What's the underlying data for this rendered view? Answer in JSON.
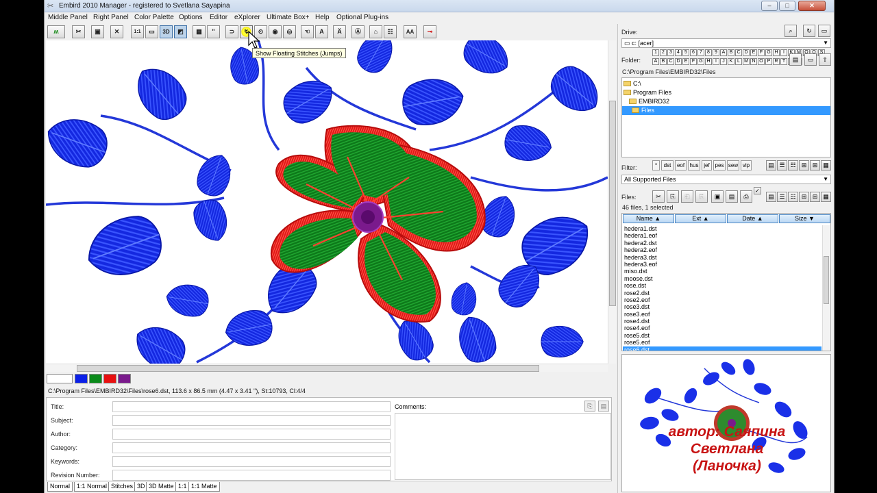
{
  "window": {
    "title": "Embird 2010 Manager - registered to Svetlana Sayapina",
    "minimize": "–",
    "maximize": "□",
    "close": "✕"
  },
  "menu": [
    "Middle Panel",
    "Right Panel",
    "Color Palette",
    "Options",
    "Editor",
    "eXplorer",
    "Ultimate Box+",
    "Help",
    "Optional Plug-ins"
  ],
  "toolbar": {
    "buttons": [
      {
        "name": "stitch-view-icon",
        "glyph": "ʍ"
      },
      {
        "name": "scissors-icon",
        "glyph": "✂"
      },
      {
        "name": "camera-icon",
        "glyph": "▣"
      },
      {
        "name": "cross-icon",
        "glyph": "✕"
      },
      {
        "name": "zoom-1to1-icon",
        "glyph": "1:1"
      },
      {
        "name": "monitor-icon",
        "glyph": "▭"
      },
      {
        "name": "3d-icon",
        "glyph": "3D"
      },
      {
        "name": "3d-matte-icon",
        "glyph": "◩"
      },
      {
        "name": "ruler-icon",
        "glyph": "▦"
      },
      {
        "name": "quote-icon",
        "glyph": "\""
      },
      {
        "name": "needle-icon",
        "glyph": "⊃"
      },
      {
        "name": "floating-stitches-icon",
        "glyph": "↯"
      },
      {
        "name": "spool-icon",
        "glyph": "⊙"
      },
      {
        "name": "eye-icon",
        "glyph": "◉"
      },
      {
        "name": "thread-icon",
        "glyph": "◎"
      },
      {
        "name": "hand-icon",
        "glyph": "☜"
      },
      {
        "name": "text-a-icon",
        "glyph": "A"
      },
      {
        "name": "text-a-arrow-icon",
        "glyph": "Ä"
      },
      {
        "name": "text-frame-icon",
        "glyph": "Ⓐ"
      },
      {
        "name": "hoop-icon",
        "glyph": "⌂"
      },
      {
        "name": "grid-icon",
        "glyph": "☷"
      },
      {
        "name": "font-aa-icon",
        "glyph": "AA"
      },
      {
        "name": "key-icon",
        "glyph": "⊸"
      }
    ],
    "tooltip": "Show Floating Stitches (Jumps)"
  },
  "design": {
    "path_info": "C:\\Program Files\\EMBIRD32\\Files\\rose6.dst, 113.6 x 86.5 mm (4.47 x 3.41 ''), St:10793, Cl:4/4",
    "colors": [
      "#ffffff",
      "#0a1fe8",
      "#0a8a1a",
      "#e81010",
      "#7a1a8c"
    ]
  },
  "properties": {
    "fields": [
      "Title:",
      "Subject:",
      "Author:",
      "Category:",
      "Keywords:",
      "Revision Number:"
    ],
    "comments_label": "Comments:"
  },
  "view_tabs": [
    "Normal",
    "1:1 Normal",
    "Stitches",
    "3D",
    "3D Matte",
    "1:1",
    "1:1 Matte"
  ],
  "right_panel": {
    "drive_label": "Drive:",
    "drive_value": "c: [acer]",
    "folder_label": "Folder:",
    "folder_keys_row1": [
      "1",
      "2",
      "3",
      "4",
      "5",
      "6",
      "7",
      "8",
      "9",
      "A",
      "B",
      "C",
      "D",
      "E",
      "F",
      "G",
      "H",
      "I",
      "K",
      "M",
      "O",
      "Q",
      "S"
    ],
    "folder_keys_row2": [
      "A",
      "B",
      "C",
      "D",
      "E",
      "F",
      "G",
      "H",
      "I",
      "J",
      "K",
      "L",
      "M",
      "N",
      "O",
      "P",
      "R",
      "T",
      "V",
      "X"
    ],
    "current_path": "C:\\Program Files\\EMBIRD32\\Files",
    "tree": [
      "C:\\",
      "Program Files",
      "EMBIRD32",
      "Files"
    ],
    "filter_label": "Filter:",
    "filter_buttons": [
      "*",
      "dst",
      "eof",
      "hus",
      "jef",
      "pes",
      "sew",
      "vip"
    ],
    "filter_value": "All Supported Files",
    "files_label": "Files:",
    "files_count": "46 files, 1 selected",
    "columns": [
      "Name ▲",
      "Ext ▲",
      "Date ▲",
      "Size ▼"
    ],
    "files": [
      "hedera1.dst",
      "hedera1.eof",
      "hedera2.dst",
      "hedera2.eof",
      "hedera3.dst",
      "hedera3.eof",
      "miso.dst",
      "moose.dst",
      "rose.dst",
      "rose2.dst",
      "rose2.eof",
      "rose3.dst",
      "rose3.eof",
      "rose4.dst",
      "rose4.eof",
      "rose5.dst",
      "rose5.eof",
      "rose6.dst"
    ],
    "selected_file": "rose6.dst",
    "watermark_lines": [
      "автор: Саяпина",
      "Светлана",
      "(Ланочка)"
    ]
  }
}
